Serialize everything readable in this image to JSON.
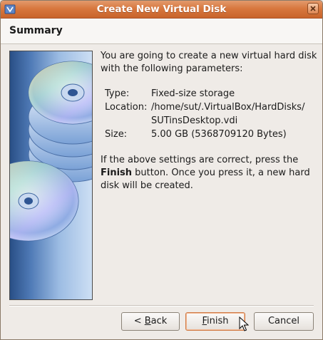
{
  "window": {
    "title": "Create New Virtual Disk",
    "app_icon": "virtualbox-icon",
    "close_icon": "close-icon"
  },
  "header": {
    "title": "Summary"
  },
  "content": {
    "intro": "You are going to create a new virtual hard disk with the following parameters:",
    "params": [
      {
        "label": "Type:",
        "value": "Fixed-size storage"
      },
      {
        "label": "Location:",
        "value_line1": "/home/sut/.VirtualBox/HardDisks/",
        "value_line2": "SUTinsDesktop.vdi"
      },
      {
        "label": "Size:",
        "value": "5.00 GB (5368709120 Bytes)"
      }
    ],
    "note_prefix": "If the above settings are correct, press the ",
    "note_bold": "Finish",
    "note_suffix": " button. Once you press it, a new hard disk will be created."
  },
  "buttons": {
    "back_prefix": "< ",
    "back_mnemonic": "B",
    "back_rest": "ack",
    "finish_mnemonic": "F",
    "finish_rest": "inish",
    "cancel_label": "Cancel"
  },
  "colors": {
    "titlebar": "#d8783f",
    "accent_border": "#d07a45",
    "side_image_dark": "#294f86",
    "side_image_light": "#cddff4"
  }
}
